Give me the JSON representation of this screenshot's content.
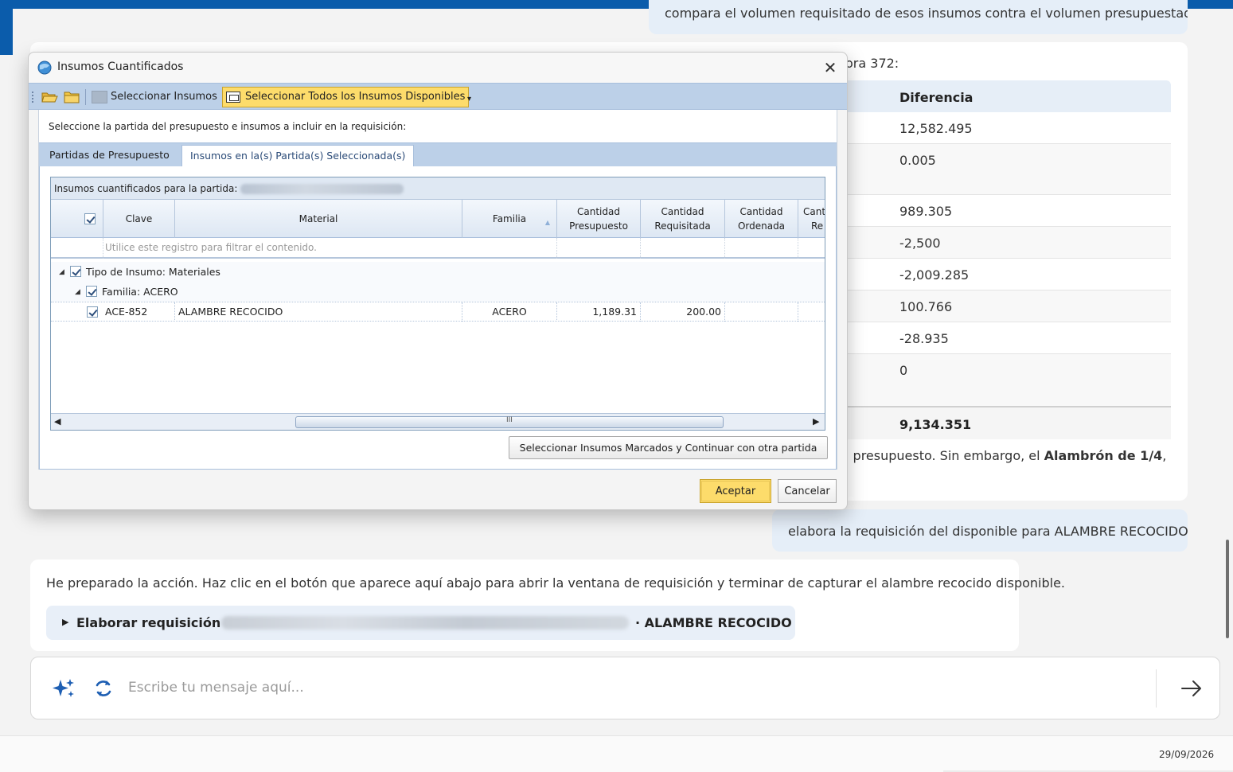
{
  "chat": {
    "top_user_message": "compara el volumen requisitado de esos insumos contra el volumen presupuestado",
    "intro_fragment": "ora 372:",
    "table": {
      "header": "Diferencia",
      "rows": [
        "12,582.495",
        "0.005",
        "989.305",
        "-2,500",
        "-2,009.285",
        "100.766",
        "-28.935",
        "0"
      ],
      "total": "9,134.351"
    },
    "after_table_text_1": "l presupuesto. Sin embargo, el ",
    "after_table_bold": "Alambrón de 1/4",
    "after_table_text_2": ",",
    "user_message_2": "elabora la requisición del disponible para ALAMBRE RECOCIDO",
    "assistant_message_2": "He preparado la acción. Haz clic en el botón que aparece aquí abajo para abrir la ventana de requisición y terminar de capturar el alambre recocido disponible.",
    "action": {
      "label": "Elaborar requisición ·",
      "suffix": "· ALAMBRE RECOCIDO"
    },
    "composer": {
      "placeholder": "Escribe tu mensaje aquí..."
    }
  },
  "status_bar": {
    "date": "29/09/2026"
  },
  "dialog": {
    "title": "Insumos Cuantificados",
    "toolbar": {
      "select_label": "Seleccionar Insumos",
      "select_all_label": "Seleccionar Todos los Insumos Disponibles"
    },
    "instruction": "Seleccione la partida del presupuesto e insumos a incluir en la requisición:",
    "tabs": [
      "Partidas de Presupuesto",
      "Insumos en la(s) Partida(s) Seleccionada(s)"
    ],
    "grid": {
      "caption": "Insumos cuantificados para la partida:",
      "columns": {
        "clave": "Clave",
        "material": "Material",
        "familia": "Familia",
        "cant_presupuesto_1": "Cantidad",
        "cant_presupuesto_2": "Presupuesto",
        "cant_requisitada_1": "Cantidad",
        "cant_requisitada_2": "Requisitada",
        "cant_ordenada_1": "Cantidad",
        "cant_ordenada_2": "Ordenada",
        "cant_re_1": "Cant",
        "cant_re_2": "Re"
      },
      "filter_hint": "Utilice este registro para filtrar el contenido.",
      "group_1": "Tipo de Insumo: Materiales",
      "group_2": "Familia: ACERO",
      "row": {
        "clave": "ACE-852",
        "material": "ALAMBRE RECOCIDO",
        "familia": "ACERO",
        "cantidad_presupuesto": "1,189.31",
        "cantidad_requisitada": "200.00"
      },
      "scroll_grip": "III"
    },
    "continue_button": "Seleccionar Insumos Marcados y Continuar con otra partida",
    "ok_button": "Aceptar",
    "cancel_button": "Cancelar"
  },
  "colors": {
    "accent": "#0b5cab",
    "highlight_button": "#fddc6b",
    "user_bubble": "#e5eef8"
  }
}
